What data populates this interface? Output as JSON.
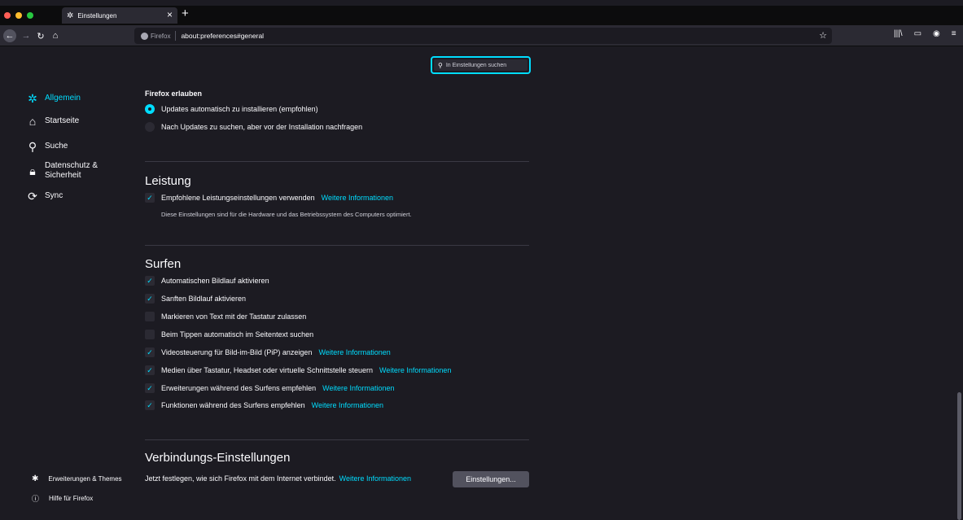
{
  "window": {
    "controls": {
      "close": "#ff5f57",
      "minimize": "#febc2e",
      "maximize": "#28c840"
    }
  },
  "tabs": [
    {
      "title": "Einstellungen",
      "icon": "gear-icon"
    }
  ],
  "navbar": {
    "identity_label": "Firefox",
    "url": "about:preferences#general"
  },
  "search": {
    "placeholder": "In Einstellungen suchen"
  },
  "sidebar": {
    "items": [
      {
        "label": "Allgemein",
        "icon": "gear-icon",
        "active": true
      },
      {
        "label": "Startseite",
        "icon": "home-icon"
      },
      {
        "label": "Suche",
        "icon": "search-icon"
      },
      {
        "label": "Datenschutz &\nSicherheit",
        "icon": "lock-icon"
      },
      {
        "label": "Sync",
        "icon": "sync-icon"
      }
    ],
    "footer": [
      {
        "label": "Erweiterungen & Themes",
        "icon": "puzzle-icon"
      },
      {
        "label": "Hilfe für Firefox",
        "icon": "help-icon"
      }
    ]
  },
  "updates": {
    "heading": "Firefox erlauben",
    "option_auto": "Updates automatisch zu installieren (empfohlen)",
    "option_ask": "Nach Updates zu suchen, aber vor der Installation nachfragen"
  },
  "performance": {
    "title": "Leistung",
    "recommended_label": "Empfohlene Leistungseinstellungen verwenden",
    "recommended_link": "Weitere Informationen",
    "description": "Diese Einstellungen sind für die Hardware und das Betriebssystem des Computers optimiert."
  },
  "browsing": {
    "title": "Surfen",
    "options": [
      {
        "label": "Automatischen Bildlauf aktivieren",
        "checked": true,
        "link": ""
      },
      {
        "label": "Sanften Bildlauf aktivieren",
        "checked": true,
        "link": ""
      },
      {
        "label": "Markieren von Text mit der Tastatur zulassen",
        "checked": false,
        "link": ""
      },
      {
        "label": "Beim Tippen automatisch im Seitentext suchen",
        "checked": false,
        "link": ""
      },
      {
        "label": "Videosteuerung für Bild-im-Bild (PiP) anzeigen",
        "checked": true,
        "link": "Weitere Informationen"
      },
      {
        "label": "Medien über Tastatur, Headset oder virtuelle Schnittstelle steuern",
        "checked": true,
        "link": "Weitere Informationen"
      },
      {
        "label": "Erweiterungen während des Surfens empfehlen",
        "checked": true,
        "link": "Weitere Informationen"
      },
      {
        "label": "Funktionen während des Surfens empfehlen",
        "checked": true,
        "link": "Weitere Informationen"
      }
    ]
  },
  "connection": {
    "title": "Verbindungs-Einstellungen",
    "description": "Jetzt festlegen, wie sich Firefox mit dem Internet verbindet.",
    "link": "Weitere Informationen",
    "button": "Einstellungen..."
  },
  "colors": {
    "accent": "#00ddff",
    "background": "#1c1b22",
    "surface": "#2b2a33"
  }
}
